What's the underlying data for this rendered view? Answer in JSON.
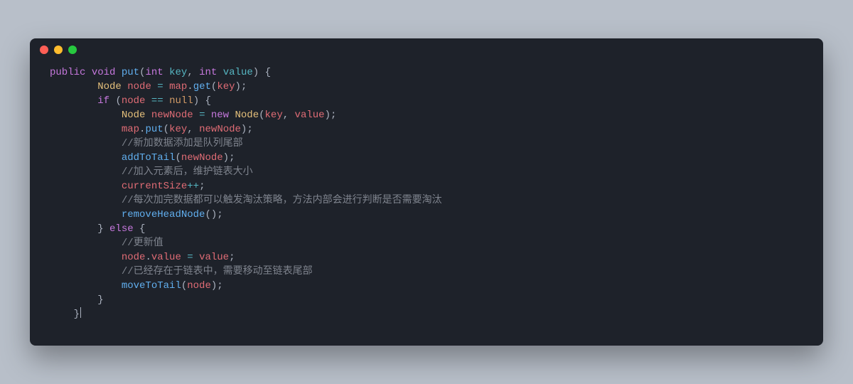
{
  "window": {
    "traffic_lights": [
      "red",
      "yellow",
      "green"
    ]
  },
  "code": {
    "tokens": [
      [
        [
          "kw",
          "public"
        ],
        [
          "sp",
          " "
        ],
        [
          "kw",
          "void"
        ],
        [
          "sp",
          " "
        ],
        [
          "fn",
          "put"
        ],
        [
          "punct",
          "("
        ],
        [
          "kw",
          "int"
        ],
        [
          "sp",
          " "
        ],
        [
          "param",
          "key"
        ],
        [
          "punct",
          ","
        ],
        [
          "sp",
          " "
        ],
        [
          "kw",
          "int"
        ],
        [
          "sp",
          " "
        ],
        [
          "param",
          "value"
        ],
        [
          "punct",
          ")"
        ],
        [
          "sp",
          " "
        ],
        [
          "punct",
          "{"
        ]
      ],
      [
        [
          "indent",
          "        "
        ],
        [
          "type",
          "Node"
        ],
        [
          "sp",
          " "
        ],
        [
          "var",
          "node"
        ],
        [
          "sp",
          " "
        ],
        [
          "op",
          "="
        ],
        [
          "sp",
          " "
        ],
        [
          "var",
          "map"
        ],
        [
          "punct",
          "."
        ],
        [
          "fn",
          "get"
        ],
        [
          "punct",
          "("
        ],
        [
          "var",
          "key"
        ],
        [
          "punct",
          ")"
        ],
        [
          "punct",
          ";"
        ]
      ],
      [
        [
          "indent",
          "        "
        ],
        [
          "kw",
          "if"
        ],
        [
          "sp",
          " "
        ],
        [
          "punct",
          "("
        ],
        [
          "var",
          "node"
        ],
        [
          "sp",
          " "
        ],
        [
          "op",
          "=="
        ],
        [
          "sp",
          " "
        ],
        [
          "null",
          "null"
        ],
        [
          "punct",
          ")"
        ],
        [
          "sp",
          " "
        ],
        [
          "punct",
          "{"
        ]
      ],
      [
        [
          "indent",
          "            "
        ],
        [
          "type",
          "Node"
        ],
        [
          "sp",
          " "
        ],
        [
          "var",
          "newNode"
        ],
        [
          "sp",
          " "
        ],
        [
          "op",
          "="
        ],
        [
          "sp",
          " "
        ],
        [
          "kw",
          "new"
        ],
        [
          "sp",
          " "
        ],
        [
          "type",
          "Node"
        ],
        [
          "punct",
          "("
        ],
        [
          "var",
          "key"
        ],
        [
          "punct",
          ","
        ],
        [
          "sp",
          " "
        ],
        [
          "var",
          "value"
        ],
        [
          "punct",
          ")"
        ],
        [
          "punct",
          ";"
        ]
      ],
      [
        [
          "indent",
          "            "
        ],
        [
          "var",
          "map"
        ],
        [
          "punct",
          "."
        ],
        [
          "fn",
          "put"
        ],
        [
          "punct",
          "("
        ],
        [
          "var",
          "key"
        ],
        [
          "punct",
          ","
        ],
        [
          "sp",
          " "
        ],
        [
          "var",
          "newNode"
        ],
        [
          "punct",
          ")"
        ],
        [
          "punct",
          ";"
        ]
      ],
      [
        [
          "indent",
          "            "
        ],
        [
          "cmt",
          "//新加数据添加是队列尾部"
        ]
      ],
      [
        [
          "indent",
          "            "
        ],
        [
          "fn",
          "addToTail"
        ],
        [
          "punct",
          "("
        ],
        [
          "var",
          "newNode"
        ],
        [
          "punct",
          ")"
        ],
        [
          "punct",
          ";"
        ]
      ],
      [
        [
          "indent",
          "            "
        ],
        [
          "cmt",
          "//加入元素后，维护链表大小"
        ]
      ],
      [
        [
          "indent",
          "            "
        ],
        [
          "var",
          "currentSize"
        ],
        [
          "op",
          "++"
        ],
        [
          "punct",
          ";"
        ]
      ],
      [
        [
          "indent",
          "            "
        ],
        [
          "cmt",
          "//每次加完数据都可以触发淘汰策略，方法内部会进行判断是否需要淘汰"
        ]
      ],
      [
        [
          "indent",
          "            "
        ],
        [
          "fn",
          "removeHeadNode"
        ],
        [
          "punct",
          "("
        ],
        [
          "punct",
          ")"
        ],
        [
          "punct",
          ";"
        ]
      ],
      [
        [
          "indent",
          "        "
        ],
        [
          "punct",
          "}"
        ],
        [
          "sp",
          " "
        ],
        [
          "kw",
          "else"
        ],
        [
          "sp",
          " "
        ],
        [
          "punct",
          "{"
        ]
      ],
      [
        [
          "indent",
          "            "
        ],
        [
          "cmt",
          "//更新值"
        ]
      ],
      [
        [
          "indent",
          "            "
        ],
        [
          "var",
          "node"
        ],
        [
          "punct",
          "."
        ],
        [
          "var",
          "value"
        ],
        [
          "sp",
          " "
        ],
        [
          "op",
          "="
        ],
        [
          "sp",
          " "
        ],
        [
          "var",
          "value"
        ],
        [
          "punct",
          ";"
        ]
      ],
      [
        [
          "indent",
          "            "
        ],
        [
          "cmt",
          "//已经存在于链表中，需要移动至链表尾部"
        ]
      ],
      [
        [
          "indent",
          "            "
        ],
        [
          "fn",
          "moveToTail"
        ],
        [
          "punct",
          "("
        ],
        [
          "var",
          "node"
        ],
        [
          "punct",
          ")"
        ],
        [
          "punct",
          ";"
        ]
      ],
      [
        [
          "indent",
          "        "
        ],
        [
          "punct",
          "}"
        ]
      ],
      [
        [
          "sp",
          ""
        ]
      ],
      [
        [
          "indent",
          "    "
        ],
        [
          "punct",
          "}"
        ],
        [
          "cursor",
          ""
        ]
      ]
    ]
  }
}
